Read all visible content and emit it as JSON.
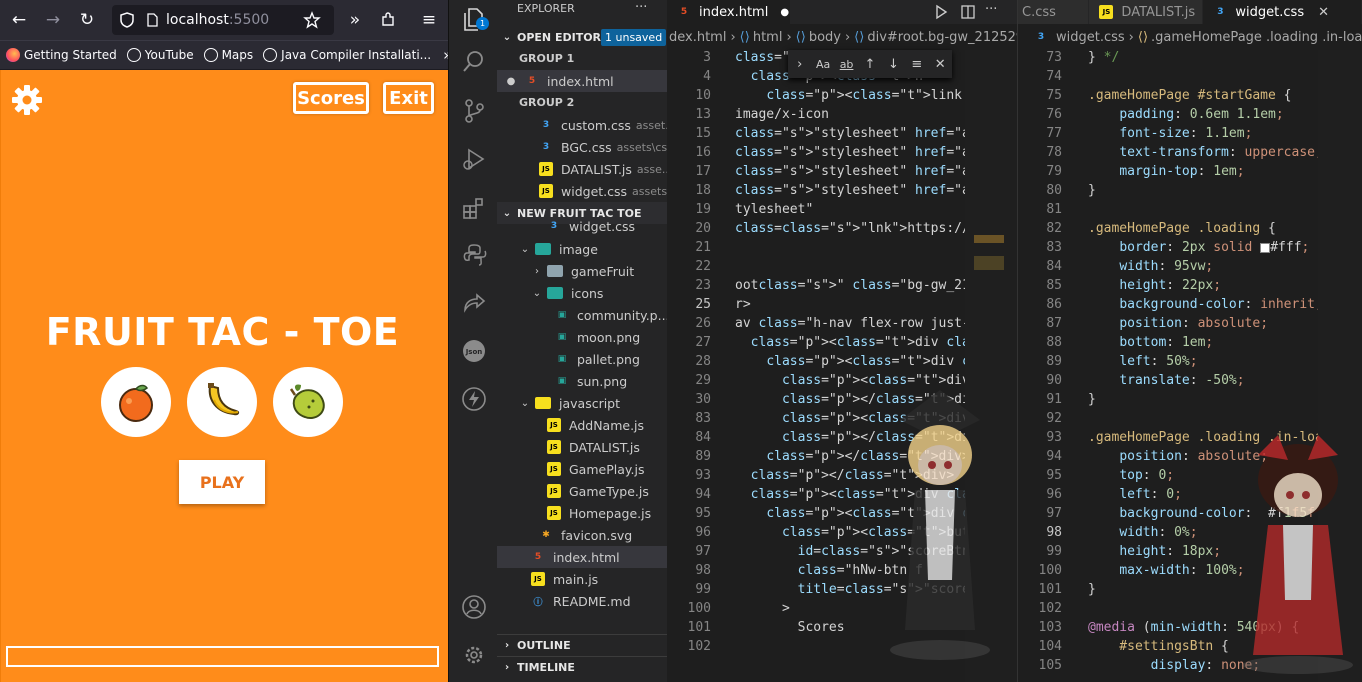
{
  "browser": {
    "url_host": "localhost",
    "url_port": ":5500",
    "bookmarks": [
      "Getting Started",
      "YouTube",
      "Maps",
      "Java Compiler Installati..."
    ],
    "bookmarks_more": "»"
  },
  "game": {
    "scores_label": "Scores",
    "exit_label": "Exit",
    "title": "FRUIT TAC - TOE",
    "play_label": "PLAY",
    "fruits": [
      "orange",
      "banana",
      "pear"
    ],
    "accent": "#ff8c1a"
  },
  "vscode": {
    "badge": "1",
    "explorer_title": "EXPLORER",
    "explorer_more": "···",
    "open_editors": "OPEN EDITORS",
    "unsaved": "1 unsaved",
    "group1": "GROUP 1",
    "group2": "GROUP 2",
    "group1_files": [
      {
        "name": "index.html",
        "sub": ""
      }
    ],
    "group2_files": [
      {
        "name": "custom.css",
        "sub": "asset..."
      },
      {
        "name": "BGC.css",
        "sub": "assets\\css"
      },
      {
        "name": "DATALIST.js",
        "sub": "asse..."
      },
      {
        "name": "widget.css",
        "sub": "assets..."
      }
    ],
    "project": "NEW FRUIT TAC TOE",
    "tree": [
      {
        "name": "widget.css"
      },
      {
        "name": "image"
      },
      {
        "name": "gameFruit"
      },
      {
        "name": "icons"
      },
      {
        "name": "community.p..."
      },
      {
        "name": "moon.png"
      },
      {
        "name": "pallet.png"
      },
      {
        "name": "sun.png"
      },
      {
        "name": "javascript"
      },
      {
        "name": "AddName.js"
      },
      {
        "name": "DATALIST.js"
      },
      {
        "name": "GamePlay.js"
      },
      {
        "name": "GameType.js"
      },
      {
        "name": "Homepage.js"
      },
      {
        "name": "favicon.svg"
      },
      {
        "name": "index.html"
      },
      {
        "name": "main.js"
      },
      {
        "name": "README.md"
      }
    ],
    "outline": "OUTLINE",
    "timeline": "TIMELINE",
    "editor1": {
      "tab": "index.html",
      "tab_dot": "●",
      "crumbs": [
        "dex.html",
        "html",
        "body",
        "div#root.bg-gw_212529"
      ],
      "lines": [
        "3",
        "4",
        "10",
        "13",
        "15",
        "16",
        "17",
        "18",
        "19",
        "20",
        "21",
        "22",
        "23",
        "25",
        "26",
        "27",
        "28",
        "29",
        "30",
        "83",
        "84",
        "89",
        "93",
        "94",
        "95",
        "96",
        "97",
        "98",
        "99",
        "100",
        "101",
        "102"
      ],
      "code": [
        "<html",
        "  <h",
        "    <link",
        "image/x-icon",
        "\"stylesheet\" href=\"assets/css/",
        "\"stylesheet\" href=\"assets/css/",
        "\"stylesheet\" href=\"assets/css/",
        "\"stylesheet\" href=\"assets/css/",
        "tylesheet\"",
        "https://cdnjs.cloudflare.com/a",
        "",
        "",
        "oot\" class=\"bg-gw_212529\">",
        "r>",
        "av class=\"h-nav flex-row just-",
        "  <div class=\"settings-contain",
        "    <div class=\"container fl",
        "      <div class=\"setters",
        "      </div>",
        "      <div class=\"btn-box\"",
        "      </div>",
        "    </div>",
        "  </div>",
        "  <div class=\"btn-box\">",
        "    <div class=\"container fl",
        "      <button",
        "        id=\"scoreBtn\"",
        "        class=\"hNw-btn f",
        "        title=\"scores\"",
        "      >",
        "        Scores"
      ]
    },
    "editor2": {
      "tabs": [
        "C.css",
        "DATALIST.js",
        "widget.css"
      ],
      "crumbs": [
        "widget.css",
        ".gameHomePage .loading .in-loading"
      ],
      "lines": [
        "73",
        "74",
        "75",
        "76",
        "77",
        "78",
        "79",
        "80",
        "81",
        "82",
        "83",
        "84",
        "85",
        "86",
        "87",
        "88",
        "89",
        "90",
        "91",
        "92",
        "93",
        "94",
        "95",
        "96",
        "97",
        "98",
        "99",
        "100",
        "101",
        "102",
        "103",
        "104",
        "105"
      ],
      "code": [
        "} */",
        "",
        ".gameHomePage #startGame {",
        "    padding: 0.6em 1.1em;",
        "    font-size: 1.1em;",
        "    text-transform: uppercase;",
        "    margin-top: 1em;",
        "}",
        "",
        ".gameHomePage .loading {",
        "    border: 2px solid  #fff;",
        "    width: 95vw;",
        "    height: 22px;",
        "    background-color: inherit;",
        "    position: absolute;",
        "    bottom: 1em;",
        "    left: 50%;",
        "    translate: -50%;",
        "}",
        "",
        ".gameHomePage .loading .in-loa",
        "    position: absolute;",
        "    top: 0;",
        "    left: 0;",
        "    background-color:  #f1f5f",
        "    width: 0%;",
        "    height: 18px;",
        "    max-width: 100%;",
        "}",
        "",
        "@media (min-width: 540px) {",
        "    #settingsBtn {",
        "        display: none;"
      ]
    }
  }
}
